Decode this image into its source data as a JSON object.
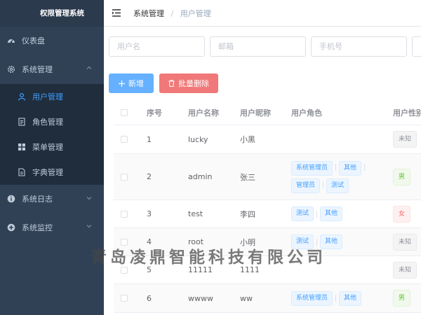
{
  "app": {
    "title": "权限管理系统"
  },
  "sidebar": {
    "dashboard": "仪表盘",
    "system": "系统管理",
    "system_children": [
      "用户管理",
      "角色管理",
      "菜单管理",
      "字典管理"
    ],
    "log": "系统日志",
    "monitor": "系统监控"
  },
  "breadcrumb": {
    "parent": "系统管理",
    "separator": "/",
    "current": "用户管理"
  },
  "filters": {
    "username_placeholder": "用户名",
    "email_placeholder": "邮箱",
    "phone_placeholder": "手机号"
  },
  "toolbar": {
    "add_label": "新增",
    "batch_delete_label": "批量删除"
  },
  "table": {
    "columns": [
      "序号",
      "用户名称",
      "用户昵称",
      "用户角色",
      "用户性别"
    ],
    "rows": [
      {
        "no": "1",
        "name": "lucky",
        "nick": "小黑",
        "roles": [],
        "gender": "未知"
      },
      {
        "no": "2",
        "name": "admin",
        "nick": "张三",
        "roles": [
          "系统管理员",
          "其他",
          "管理员",
          "测试"
        ],
        "gender": "男"
      },
      {
        "no": "3",
        "name": "test",
        "nick": "李四",
        "roles": [
          "测试",
          "其他"
        ],
        "gender": "女"
      },
      {
        "no": "4",
        "name": "root",
        "nick": "小明",
        "roles": [
          "测试",
          "其他"
        ],
        "gender": "未知"
      },
      {
        "no": "5",
        "name": "11111",
        "nick": "1111",
        "roles": [],
        "gender": "未知"
      },
      {
        "no": "6",
        "name": "wwww",
        "nick": "ww",
        "roles": [
          "系统管理员",
          "其他"
        ],
        "gender": "男"
      }
    ]
  },
  "watermark": "青岛凌鼎智能科技有限公司",
  "colors": {
    "sidebar_bg": "#304156",
    "accent": "#409eff",
    "danger": "#f56c6c"
  }
}
